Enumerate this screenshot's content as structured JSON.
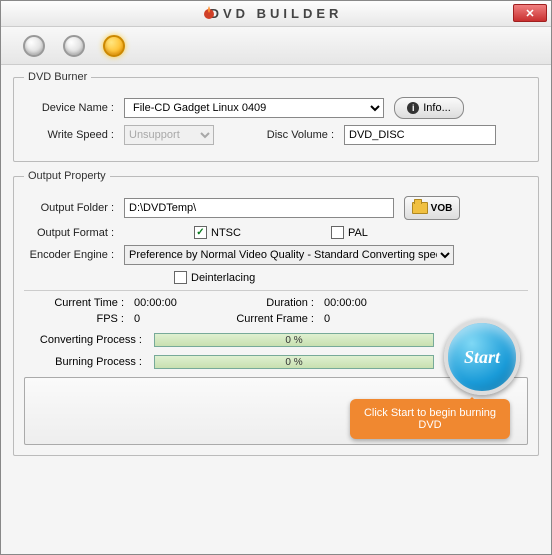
{
  "title": "DVD BUILDER",
  "burner": {
    "legend": "DVD Burner",
    "deviceLabel": "Device Name  :",
    "device": "File-CD Gadget   Linux   0409",
    "infoLabel": "Info...",
    "writeSpeedLabel": "Write Speed  :",
    "writeSpeed": "Unsupport",
    "discVolumeLabel": "Disc Volume  :",
    "discVolume": "DVD_DISC"
  },
  "output": {
    "legend": "Output Property",
    "folderLabel": "Output Folder  :",
    "folder": "D:\\DVDTemp\\",
    "vobLabel": "VOB",
    "formatLabel": "Output Format  :",
    "ntscLabel": "NTSC",
    "ntscChecked": true,
    "palLabel": "PAL",
    "palChecked": false,
    "encoderLabel": "Encoder Engine  :",
    "encoder": "Preference by Normal Video Quality - Standard Converting speed",
    "deinterlaceLabel": "Deinterlacing",
    "deinterlaceChecked": false
  },
  "stats": {
    "currentTimeLabel": "Current Time  :",
    "currentTime": "00:00:00",
    "durationLabel": "Duration  :",
    "duration": "00:00:00",
    "fpsLabel": "FPS  :",
    "fps": "0",
    "currentFrameLabel": "Current Frame  :",
    "currentFrame": "0",
    "convLabel": "Converting Process  :",
    "convPercent": "0 %",
    "burnLabel": "Burning Process  :",
    "burnPercent": "0 %"
  },
  "startLabel": "Start",
  "tooltip": "Click Start to begin burning DVD"
}
